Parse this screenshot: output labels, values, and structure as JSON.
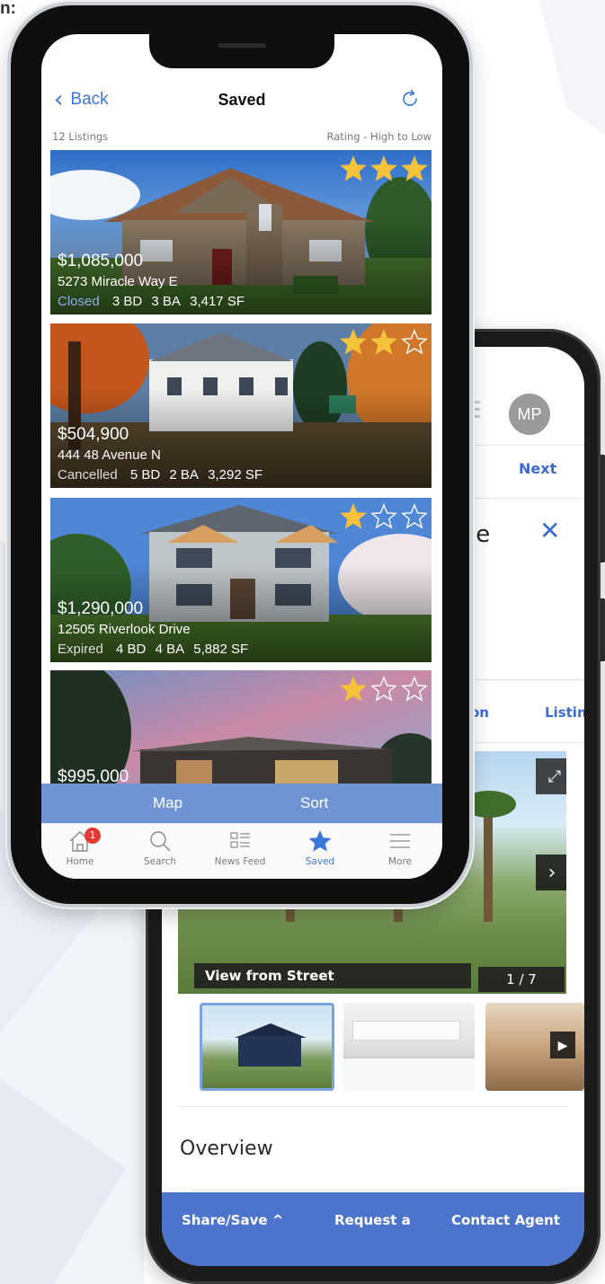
{
  "corner_text": "n:",
  "front": {
    "nav": {
      "back_label": "Back",
      "title": "Saved"
    },
    "list_count": "12 Listings",
    "sort_label": "Rating - High to Low",
    "listings": [
      {
        "price": "$1,085,000",
        "address": "5273 Miracle Way E",
        "status": "Closed",
        "beds": "3 BD",
        "baths": "3 BA",
        "sqft": "3,417 SF",
        "rating": 3
      },
      {
        "price": "$504,900",
        "address": "444 48 Avenue N",
        "status": "Cancelled",
        "beds": "5 BD",
        "baths": "2 BA",
        "sqft": "3,292 SF",
        "rating": 2
      },
      {
        "price": "$1,290,000",
        "address": "12505 Riverlook Drive",
        "status": "Expired",
        "beds": "4 BD",
        "baths": "4 BA",
        "sqft": "5,882 SF",
        "rating": 1
      },
      {
        "price": "$995,000",
        "address": "",
        "status": "",
        "beds": "",
        "baths": "",
        "sqft": "",
        "rating": 1
      }
    ],
    "map_label": "Map",
    "sort_button_label": "Sort",
    "tabs": [
      {
        "label": "Home",
        "icon": "home-icon",
        "badge": "1"
      },
      {
        "label": "Search",
        "icon": "search-icon"
      },
      {
        "label": "News Feed",
        "icon": "news-feed-icon"
      },
      {
        "label": "Saved",
        "icon": "star-icon",
        "active": true
      },
      {
        "label": "More",
        "icon": "menu-icon"
      }
    ],
    "colors": {
      "accent": "#3a78d8",
      "map_bar": "#6f94d6",
      "star": "#f5c33b",
      "badge": "#e53935"
    }
  },
  "back": {
    "avatar_initials": "MP",
    "next_label": "Next",
    "title_fragment": "le",
    "tab_fragment_1": "on",
    "tab_fragment_2": "Listin",
    "photo_caption": "View from Street",
    "photo_counter": "1 / 7",
    "section_title": "Overview",
    "bottom_bar": {
      "share": "Share/Save ^",
      "request": "Request a",
      "contact": "Contact Agent"
    },
    "colors": {
      "accent": "#3c6bd3",
      "bottom_bar": "#4c74cd"
    }
  }
}
